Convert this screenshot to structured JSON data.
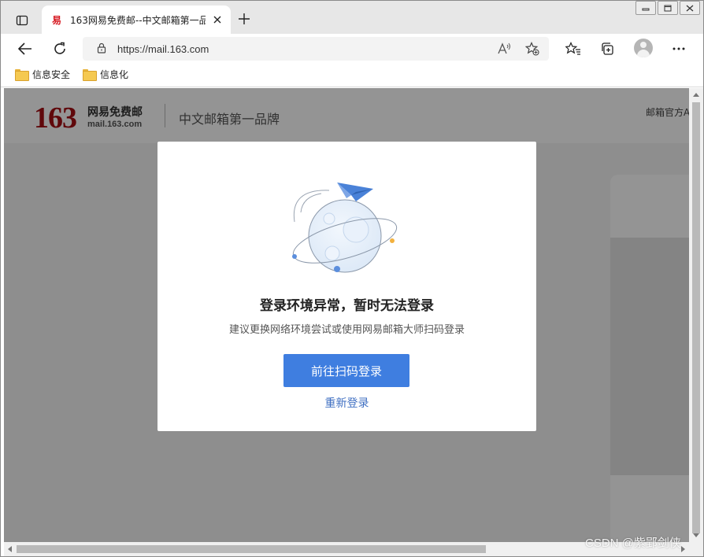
{
  "browser": {
    "tab": {
      "favicon": "易",
      "title": "163网易免费邮--中文邮箱第一品牌"
    },
    "address": {
      "url": "https://mail.163.com"
    },
    "bookmarks": [
      {
        "label": "信息安全"
      },
      {
        "label": "信息化"
      }
    ],
    "icons": {
      "tab_actions": "tab-actions-icon",
      "close": "close-icon",
      "new_tab": "plus-icon",
      "back": "back-arrow-icon",
      "refresh": "refresh-icon",
      "lock": "lock-icon",
      "read_aloud": "read-aloud-icon",
      "add_favorite": "add-favorite-icon",
      "favorites": "favorites-icon",
      "collections": "collections-icon",
      "profile": "profile-icon",
      "more": "more-icon"
    },
    "colors": {
      "tabbar": "#e7e7e7",
      "accent": "#3f7ee0"
    }
  },
  "page": {
    "header": {
      "logo_number": "163",
      "logo_cn": "网易免费邮",
      "logo_en": "mail.163.com",
      "slogan": "中文邮箱第一品牌",
      "official_link": "邮箱官方A"
    }
  },
  "modal": {
    "title": "登录环境异常，暂时无法登录",
    "subtitle": "建议更换网络环境尝试或使用网易邮箱大师扫码登录",
    "primary_button": "前往扫码登录",
    "secondary_link": "重新登录"
  },
  "watermark": "CSDN @紫郢剑侠"
}
